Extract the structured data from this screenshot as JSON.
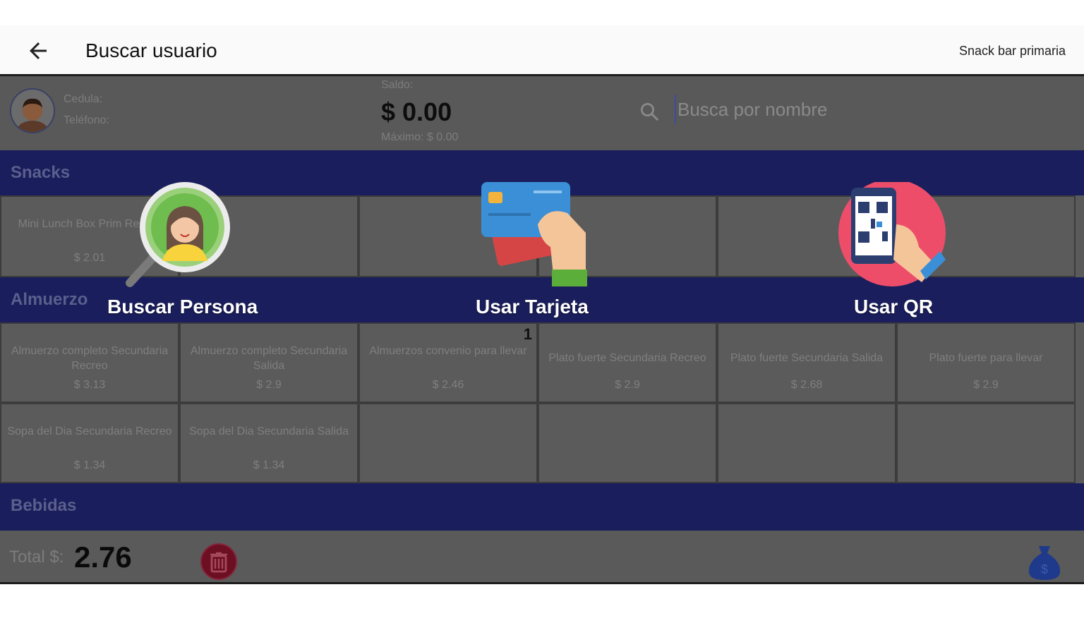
{
  "header": {
    "title": "Buscar usuario",
    "location": "Snack bar primaria"
  },
  "user": {
    "cedula_label": "Cedula:",
    "telefono_label": "Teléfono:",
    "saldo_label": "Saldo:",
    "saldo_value": "$ 0.00",
    "maximo": "Máximo: $ 0.00"
  },
  "search": {
    "placeholder": "Busca por nombre"
  },
  "sections": {
    "snacks": {
      "title": "Snacks",
      "items": [
        {
          "name": "Mini Lunch Box Prim Recreo",
          "price": "$ 2.01"
        }
      ]
    },
    "almuerzo": {
      "title": "Almuerzo",
      "items": [
        {
          "name": "Almuerzo completo Secundaria Recreo",
          "price": "$ 3.13"
        },
        {
          "name": "Almuerzo completo Secundaria Salida",
          "price": "$ 2.9"
        },
        {
          "name": "Almuerzos convenio para llevar",
          "price": "$ 2.46",
          "qty": "1"
        },
        {
          "name": "Plato fuerte Secundaria Recreo",
          "price": "$ 2.9"
        },
        {
          "name": "Plato fuerte Secundaria Salida",
          "price": "$ 2.68"
        },
        {
          "name": "Plato fuerte para llevar",
          "price": "$ 2.9"
        },
        {
          "name": "Sopa del Dia Secundaria Recreo",
          "price": "$ 1.34"
        },
        {
          "name": "Sopa del Dia Secundaria Salida",
          "price": "$ 1.34"
        }
      ]
    },
    "bebidas": {
      "title": "Bebidas"
    }
  },
  "footer": {
    "total_label": "Total $:",
    "total_value": "2.76"
  },
  "options": {
    "buscar": "Buscar Persona",
    "tarjeta": "Usar Tarjeta",
    "qr": "Usar QR"
  },
  "colors": {
    "section_bar": "#1a1e5c",
    "overlay_bg": "#5a5a5a",
    "trash": "#6d0f22",
    "bag": "#1f3a8a"
  }
}
